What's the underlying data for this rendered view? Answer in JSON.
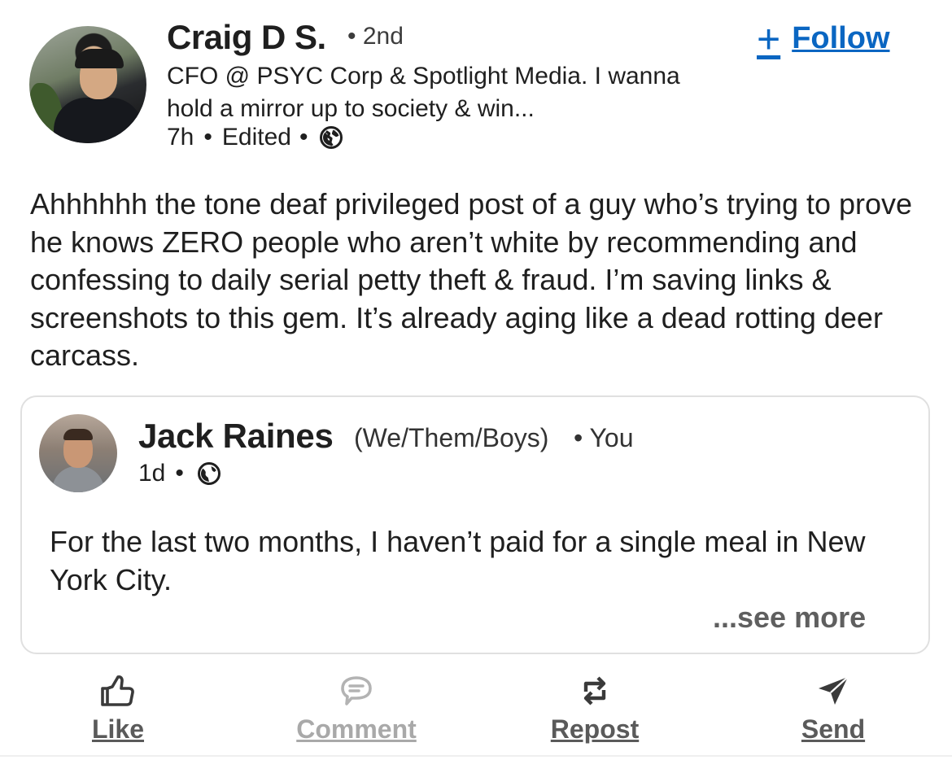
{
  "post": {
    "author": {
      "name": "Craig D S.",
      "degree": "• 2nd",
      "headline": "CFO @ PSYC Corp & Spotlight Media. I wanna hold a mirror up to society & win...",
      "time": "7h",
      "edited": "Edited",
      "sep1": "•",
      "sep2": "•"
    },
    "follow_label": "Follow",
    "body": "Ahhhhhh the tone deaf privileged post of a guy who’s trying to prove he knows ZERO people who aren’t white by recommending and confessing to daily serial petty theft & fraud. I’m saving links & screenshots to this gem. It’s already aging like a dead rotting deer carcass."
  },
  "shared": {
    "name": "Jack Raines",
    "pronouns": "(We/Them/Boys)",
    "relation": "• You",
    "time": "1d",
    "sep": "•",
    "body": "For the last two months, I haven’t paid for a single meal in New York City.",
    "see_more": "...see more"
  },
  "actions": {
    "like": "Like",
    "comment": "Comment",
    "repost": "Repost",
    "send": "Send"
  },
  "colors": {
    "accent": "#0a66c2",
    "text": "#1f1f1f",
    "muted": "#5a5a5a",
    "disabled": "#a9a9a9"
  },
  "icons": [
    "globe-icon",
    "plus-icon",
    "like-icon",
    "comment-icon",
    "repost-icon",
    "send-icon"
  ]
}
